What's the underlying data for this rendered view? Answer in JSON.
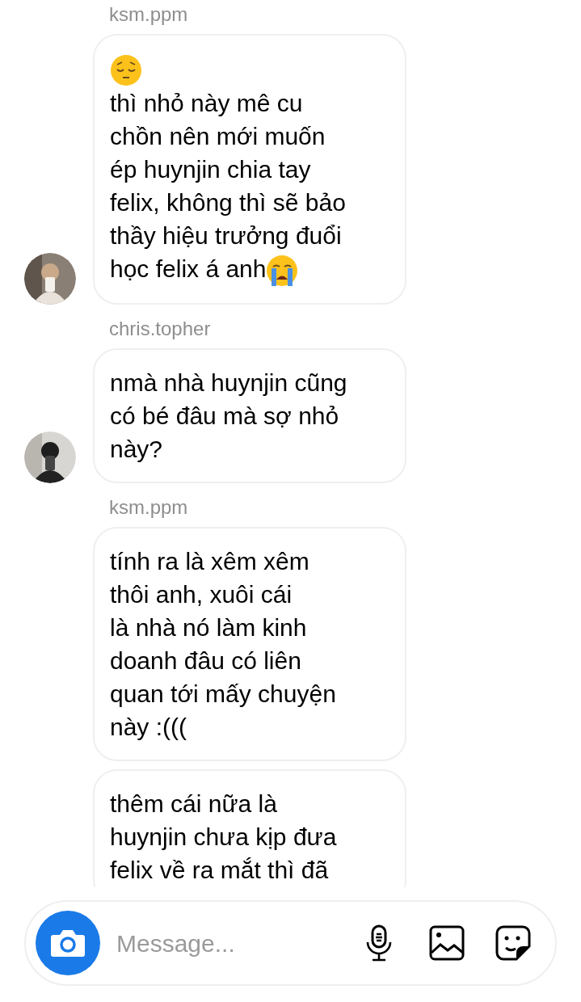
{
  "groups": [
    {
      "sender": "ksm.ppm",
      "avatar": {
        "kind": "picture"
      },
      "messages": [
        {
          "lines": [
            [
              {
                "kind": "pensive"
              }
            ],
            [
              {
                "kind": "text",
                "text": "thì nhỏ này mê cu"
              }
            ],
            [
              {
                "kind": "text",
                "text": "chồn nên mới muốn"
              }
            ],
            [
              {
                "kind": "text",
                "text": "ép huynjin chia tay"
              }
            ],
            [
              {
                "kind": "text",
                "text": "felix, không thì sẽ bảo"
              }
            ],
            [
              {
                "kind": "text",
                "text": "thầy hiệu trưởng đuổi"
              }
            ],
            [
              {
                "kind": "text",
                "text": "học felix á anh"
              },
              {
                "kind": "crying"
              }
            ]
          ]
        }
      ]
    },
    {
      "sender": "chris.topher",
      "avatar": {
        "kind": "picture"
      },
      "messages": [
        {
          "lines": [
            [
              {
                "kind": "text",
                "text": "nmà nhà huynjin cũng"
              }
            ],
            [
              {
                "kind": "text",
                "text": "có bé đâu mà sợ nhỏ"
              }
            ],
            [
              {
                "kind": "text",
                "text": "này?"
              }
            ]
          ]
        }
      ]
    },
    {
      "sender": "ksm.ppm",
      "messages": [
        {
          "lines": [
            [
              {
                "kind": "text",
                "text": "tính ra là xêm xêm"
              }
            ],
            [
              {
                "kind": "text",
                "text": "thôi anh, xuôi cái"
              }
            ],
            [
              {
                "kind": "text",
                "text": "là nhà nó làm kinh"
              }
            ],
            [
              {
                "kind": "text",
                "text": "doanh đâu có liên"
              }
            ],
            [
              {
                "kind": "text",
                "text": "quan tới mấy chuyện"
              }
            ],
            [
              {
                "kind": "text",
                "text": "này :((("
              }
            ]
          ]
        },
        {
          "lines": [
            [
              {
                "kind": "text",
                "text": "thêm cái nữa là"
              }
            ],
            [
              {
                "kind": "text",
                "text": "huynjin chưa kịp đưa"
              }
            ],
            [
              {
                "kind": "text",
                "text": "felix về ra mắt thì đã"
              }
            ]
          ]
        }
      ]
    }
  ],
  "composer": {
    "placeholder": "Message..."
  }
}
